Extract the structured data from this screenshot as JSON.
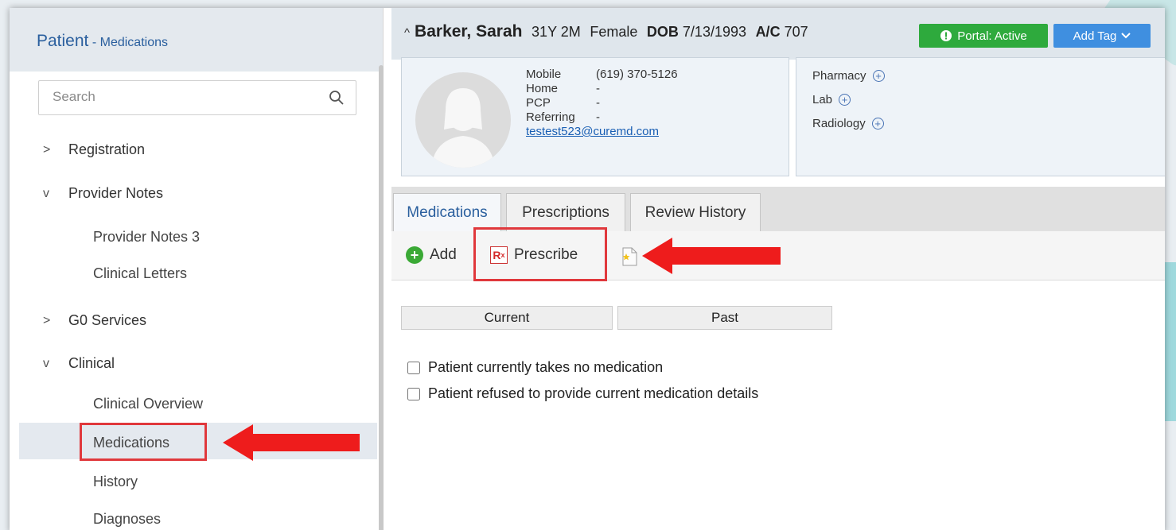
{
  "sidebar": {
    "title": "Patient",
    "subtitle": " - Medications",
    "search_placeholder": "Search",
    "sections": [
      {
        "label": "Registration",
        "chevron": ">"
      },
      {
        "label": "Provider Notes",
        "chevron": "v"
      },
      {
        "label": "G0 Services",
        "chevron": ">"
      },
      {
        "label": "Clinical",
        "chevron": "v"
      }
    ],
    "provider_notes_items": [
      "Provider Notes 3",
      "Clinical Letters"
    ],
    "clinical_items": [
      "Clinical Overview",
      "Medications",
      "History",
      "Diagnoses"
    ]
  },
  "patient": {
    "caret": "^",
    "name": "Barker, Sarah",
    "age": "31Y 2M",
    "gender": "Female",
    "dob_label": "DOB",
    "dob": "7/13/1993",
    "ac_label": "A/C",
    "account": "707",
    "portal_label": "Portal: Active",
    "add_tag_label": "Add Tag",
    "contact": {
      "mobile_label": "Mobile",
      "mobile": "(619) 370-5126",
      "home_label": "Home",
      "home": "-",
      "pcp_label": "PCP",
      "pcp": "-",
      "referring_label": "Referring",
      "referring": "-",
      "email": "testest523@curemd.com"
    },
    "links": [
      "Pharmacy",
      "Lab",
      "Radiology"
    ]
  },
  "tabs": [
    "Medications",
    "Prescriptions",
    "Review History"
  ],
  "toolbar": {
    "add_label": "Add",
    "prescribe_label": "Prescribe"
  },
  "segments": [
    "Current",
    "Past"
  ],
  "checkboxes": [
    "Patient currently takes no medication",
    "Patient refused to provide current medication details"
  ],
  "colors": {
    "accent": "#2a5f9e",
    "portal_green": "#2eaa3d",
    "add_tag_blue": "#3f8fe0",
    "annotation_red": "#e0383c"
  }
}
